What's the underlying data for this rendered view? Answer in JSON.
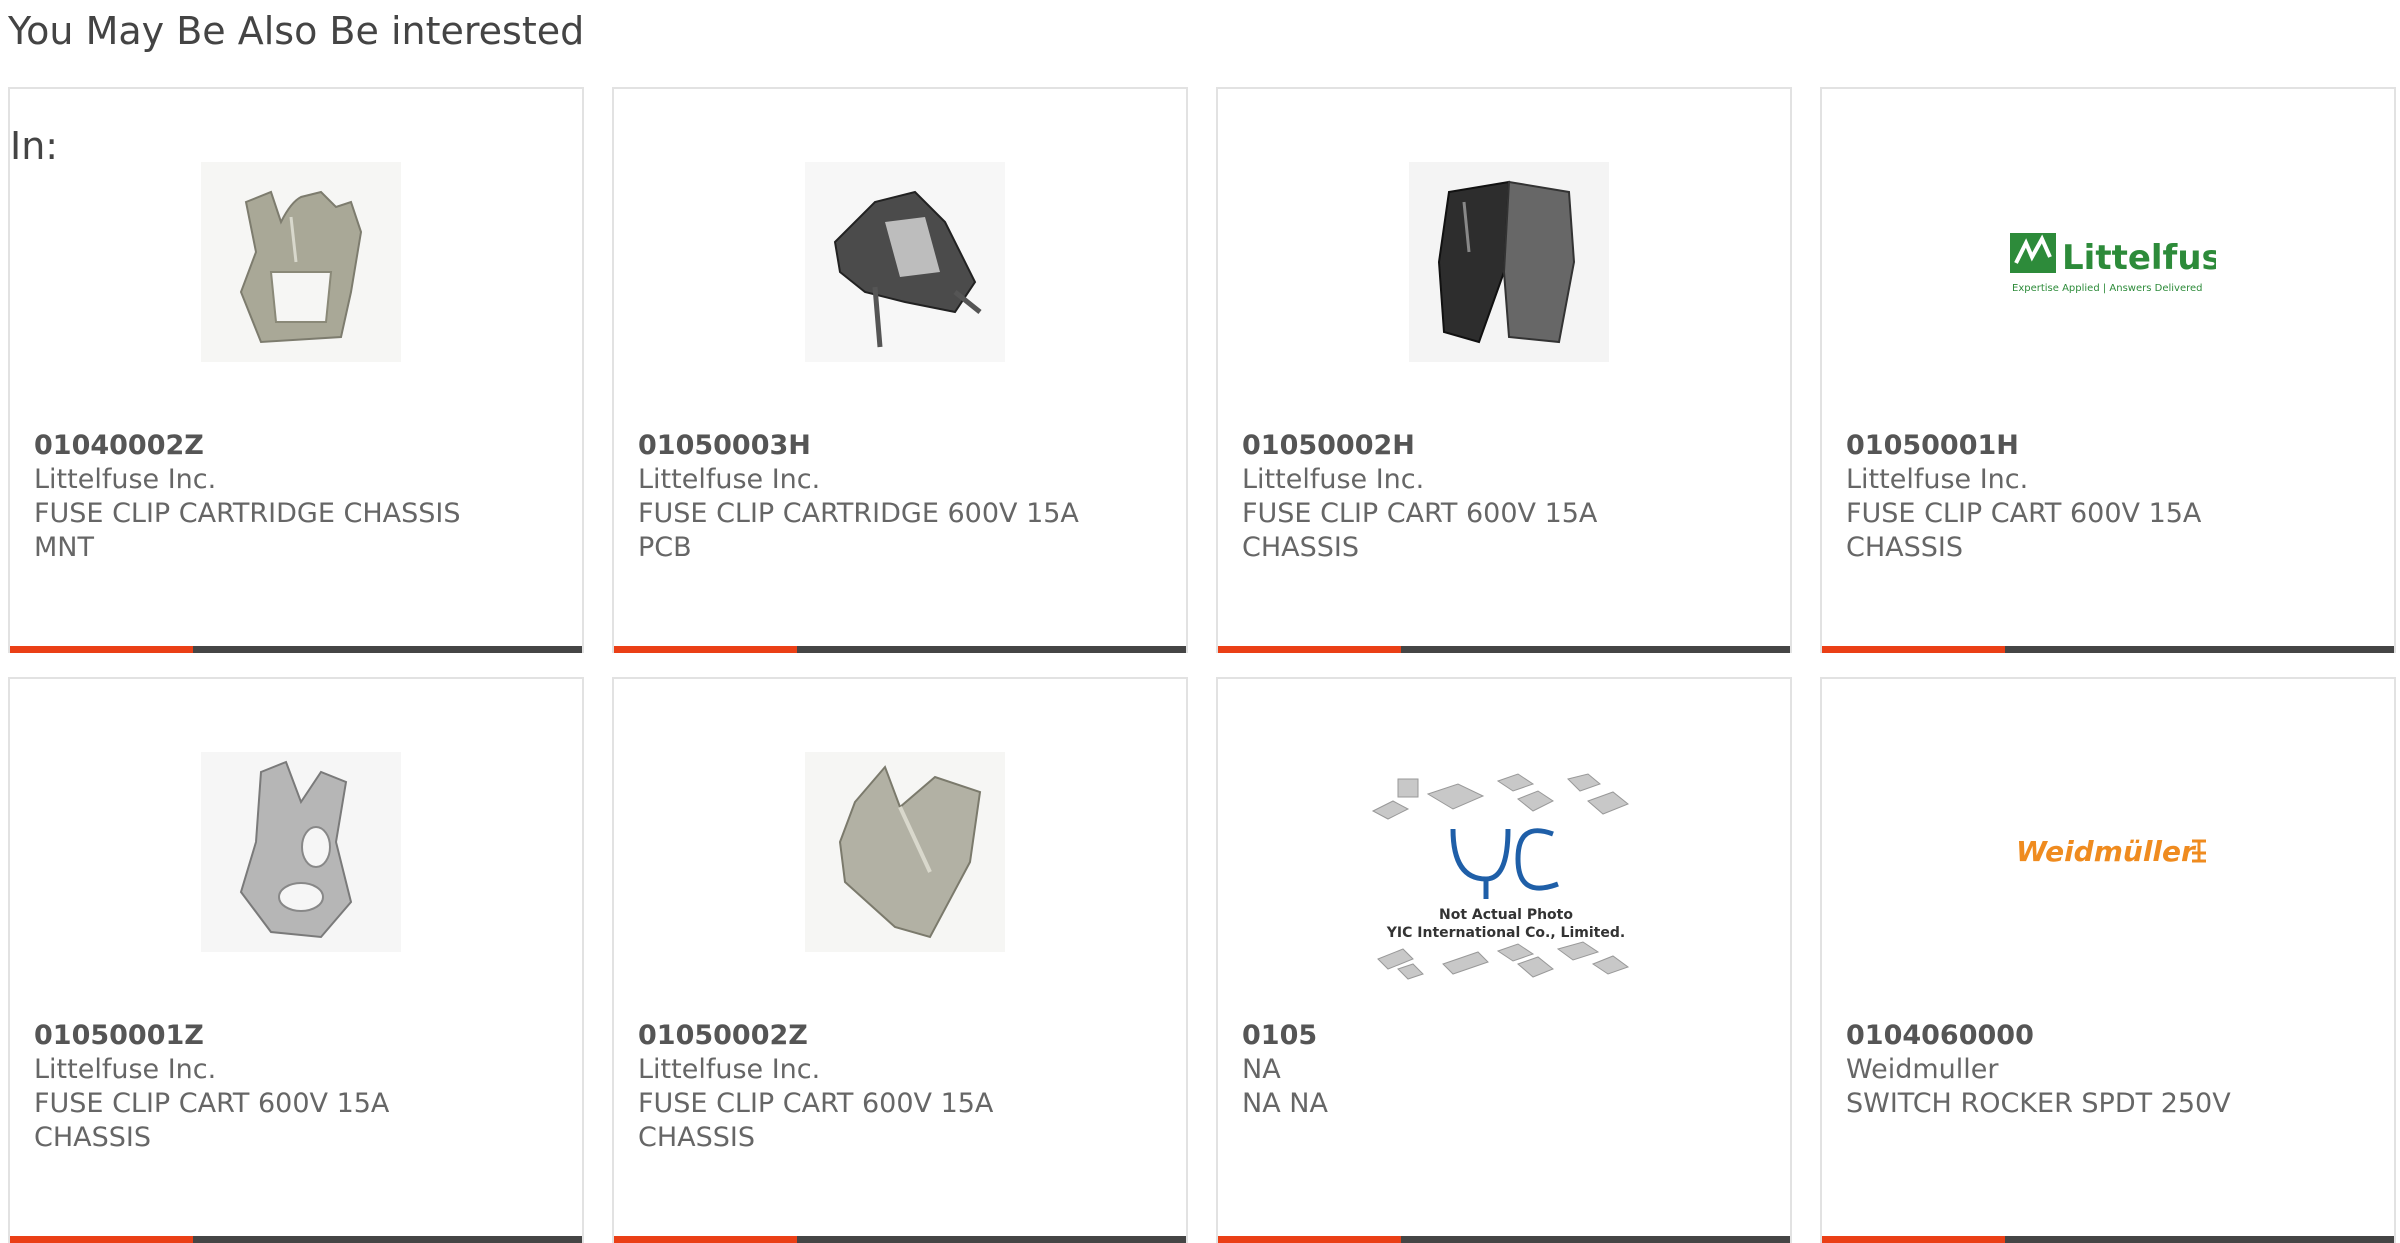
{
  "section": {
    "title": "You May Be Also Be interested",
    "title_cont": "In:"
  },
  "colors": {
    "accent": "#ea3f16",
    "bar": "#454545",
    "border": "#e2e2e2"
  },
  "products": [
    {
      "part": "01040002Z",
      "mfr": "Littelfuse Inc.",
      "desc": "FUSE CLIP CARTRIDGE CHASSIS\nMNT",
      "image": "fuse-clip-silver"
    },
    {
      "part": "01050003H",
      "mfr": "Littelfuse Inc.",
      "desc": "FUSE CLIP CARTRIDGE 600V 15A\nPCB",
      "image": "fuse-clip-pcb"
    },
    {
      "part": "01050002H",
      "mfr": "Littelfuse Inc.",
      "desc": "FUSE CLIP CART 600V 15A\nCHASSIS",
      "image": "fuse-clip-dark"
    },
    {
      "part": "01050001H",
      "mfr": "Littelfuse Inc.",
      "desc": "FUSE CLIP CART 600V 15A\nCHASSIS",
      "image": "littelfuse-logo",
      "logo_text": "Littelfuse",
      "logo_sub": "Expertise Applied | Answers Delivered"
    },
    {
      "part": "01050001Z",
      "mfr": "Littelfuse Inc.",
      "desc": "FUSE CLIP CART 600V 15A\nCHASSIS",
      "image": "fuse-clip-open"
    },
    {
      "part": "01050002Z",
      "mfr": "Littelfuse Inc.",
      "desc": "FUSE CLIP CART 600V 15A\nCHASSIS",
      "image": "fuse-clip-silver-2"
    },
    {
      "part": "0105",
      "mfr": "NA",
      "desc": "NA NA",
      "image": "yic-placeholder",
      "logo_line1": "Not Actual Photo",
      "logo_line2": "YIC International Co., Limited."
    },
    {
      "part": "0104060000",
      "mfr": "Weidmuller",
      "desc": "SWITCH ROCKER SPDT 250V",
      "image": "weidmuller-logo",
      "logo_text": "Weidmüller"
    }
  ]
}
